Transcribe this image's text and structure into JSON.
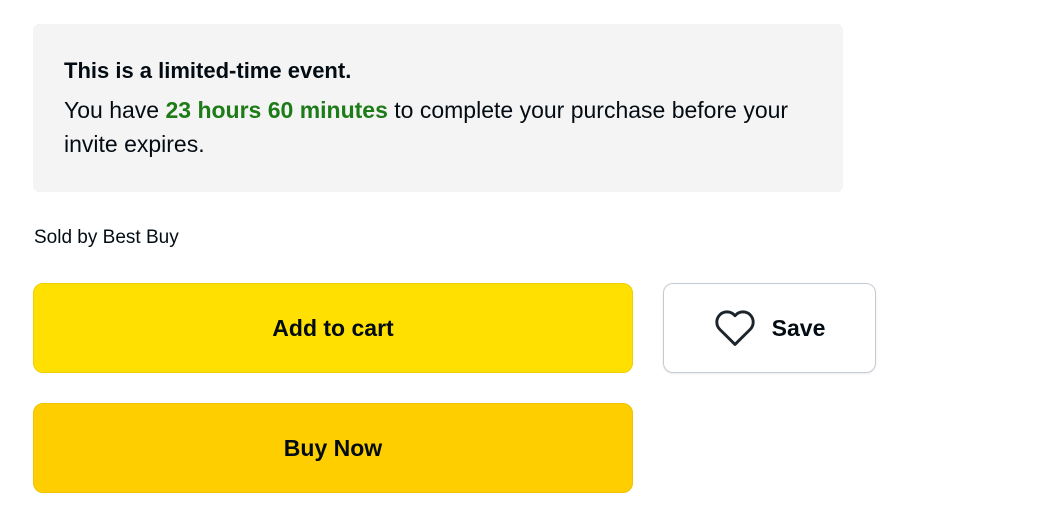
{
  "notice": {
    "heading": "This is a limited-time event.",
    "body_prefix": "You have ",
    "time_remaining": "23 hours 60 minutes",
    "body_suffix": " to complete your purchase before your invite expires."
  },
  "seller": {
    "text": "Sold by Best Buy"
  },
  "actions": {
    "add_to_cart_label": "Add to cart",
    "buy_now_label": "Buy Now",
    "save_label": "Save",
    "save_icon": "heart-outline"
  },
  "colors": {
    "add_to_cart_bg": "#ffe000",
    "buy_now_bg": "#ffce00",
    "time_highlight": "#1d7c18",
    "notice_bg": "#f4f4f4"
  }
}
